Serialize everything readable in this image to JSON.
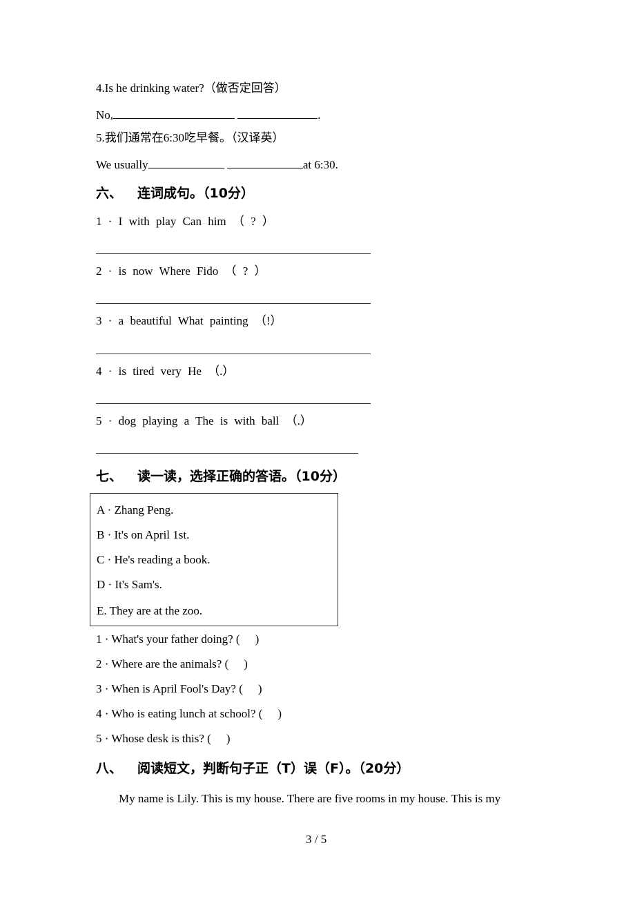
{
  "section5_tail": {
    "q4": {
      "prompt": "4.Is he drinking water?（做否定回答）",
      "answer_prefix": "No,",
      "answer_suffix": "."
    },
    "q5": {
      "prompt": "5.我们通常在6:30吃早餐。（汉译英）",
      "answer_prefix": "We usually",
      "answer_suffix": "at 6:30."
    }
  },
  "section6": {
    "number": "六、",
    "title": "连词成句。（10分）",
    "items": [
      {
        "label": "1 · I with play Can  him （ ? ）"
      },
      {
        "label": "2 · is now Where Fido （ ? ）"
      },
      {
        "label": "3 · a beautiful What painting （!）"
      },
      {
        "label": "4 · is tired very He （.）"
      },
      {
        "label": "5 · dog playing a The is with ball （.）"
      }
    ]
  },
  "section7": {
    "number": "七、",
    "title": "读一读，选择正确的答语。（10分）",
    "options": [
      {
        "label": "A · Zhang Peng."
      },
      {
        "label": "B · It's on April 1st."
      },
      {
        "label": "C · He's reading a book."
      },
      {
        "label": "D · It's Sam's."
      },
      {
        "label": "E. They are at the zoo."
      }
    ],
    "questions": [
      {
        "label": "1 · What's your father doing? (",
        "close": ")"
      },
      {
        "label": "2 · Where are the animals? (",
        "close": ")"
      },
      {
        "label": "3 · When is April Fool's Day? (",
        "close": ")"
      },
      {
        "label": "4 · Who is eating lunch at school? (",
        "close": ")"
      },
      {
        "label": "5 · Whose desk is this? (",
        "close": ")"
      }
    ]
  },
  "section8": {
    "number": "八、",
    "title": "阅读短文，判断句子正（T）误（F）。（20分）",
    "passage_start": "My name is Lily. This is my house. There are five rooms in my house. This is my"
  },
  "footer": {
    "page_indicator": "3 / 5"
  }
}
